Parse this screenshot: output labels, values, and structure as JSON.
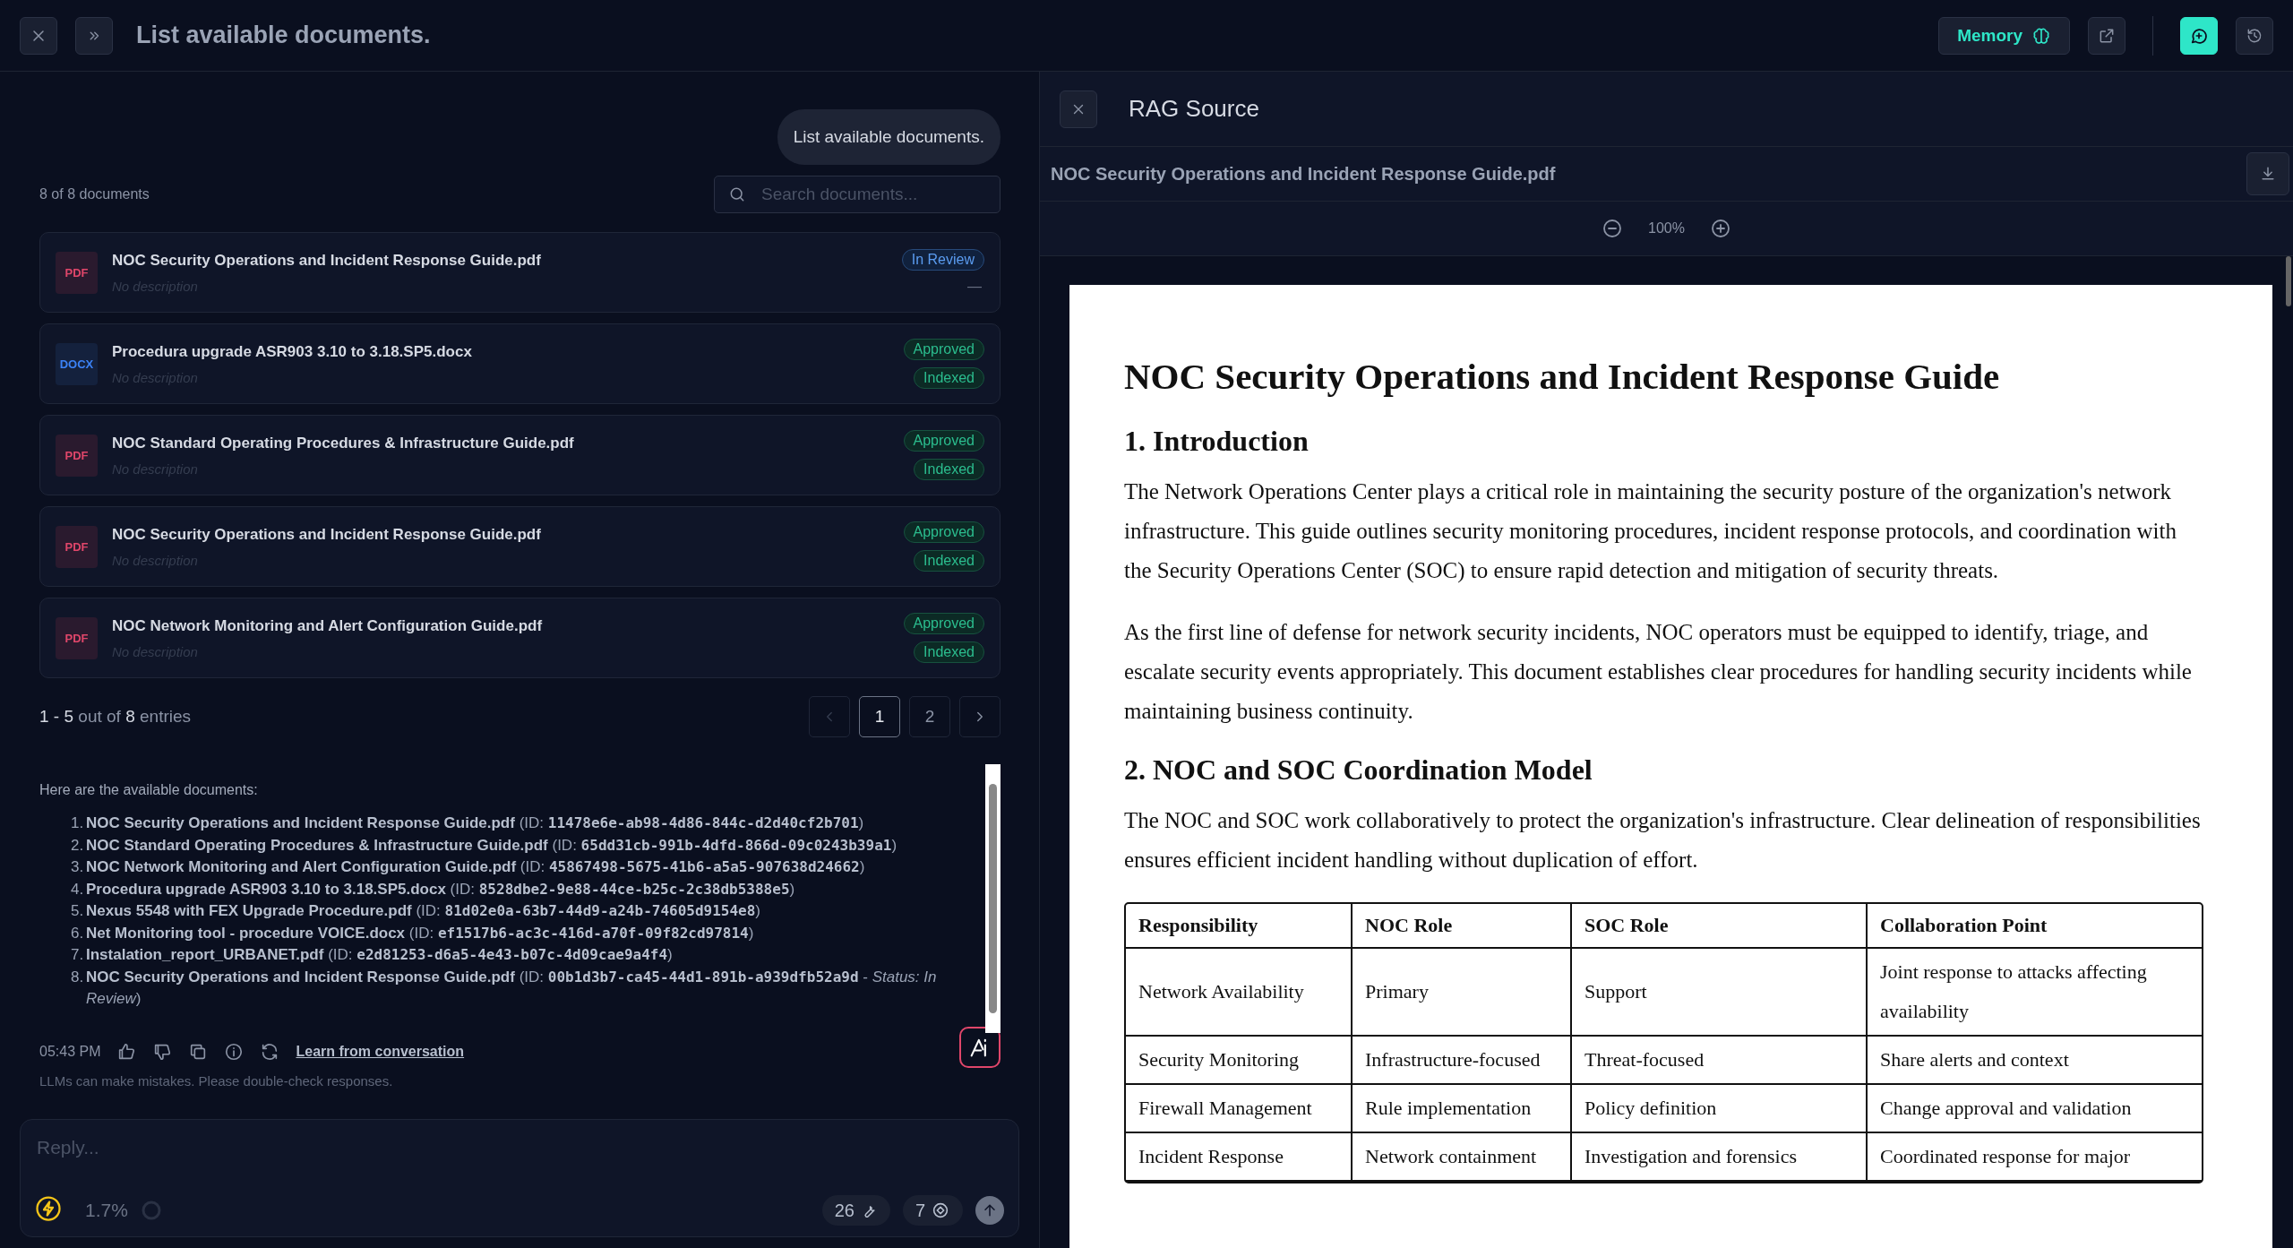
{
  "top_bar": {
    "title": "List available documents.",
    "memory_button": "Memory"
  },
  "chat": {
    "user_message": "List available documents.",
    "document_list": {
      "count_label": "8 of 8 documents",
      "search": {
        "placeholder": "Search documents..."
      },
      "documents": [
        {
          "file_type": "PDF",
          "kind": "pdf",
          "name": "NOC Security Operations and Incident Response Guide.pdf",
          "description": "No description",
          "badges": [
            {
              "label": "In Review",
              "kind": "review"
            },
            {
              "label": "—",
              "kind": "dash"
            }
          ]
        },
        {
          "file_type": "DOCX",
          "kind": "docx",
          "name": "Procedura upgrade ASR903 3.10 to 3.18.SP5.docx",
          "description": "No description",
          "badges": [
            {
              "label": "Approved",
              "kind": "approved"
            },
            {
              "label": "Indexed",
              "kind": "approved"
            }
          ]
        },
        {
          "file_type": "PDF",
          "kind": "pdf",
          "name": "NOC Standard Operating Procedures & Infrastructure Guide.pdf",
          "description": "No description",
          "badges": [
            {
              "label": "Approved",
              "kind": "approved"
            },
            {
              "label": "Indexed",
              "kind": "approved"
            }
          ]
        },
        {
          "file_type": "PDF",
          "kind": "pdf",
          "name": "NOC Security Operations and Incident Response Guide.pdf",
          "description": "No description",
          "badges": [
            {
              "label": "Approved",
              "kind": "approved"
            },
            {
              "label": "Indexed",
              "kind": "approved"
            }
          ]
        },
        {
          "file_type": "PDF",
          "kind": "pdf",
          "name": "NOC Network Monitoring and Alert Configuration Guide.pdf",
          "description": "No description",
          "badges": [
            {
              "label": "Approved",
              "kind": "approved"
            },
            {
              "label": "Indexed",
              "kind": "approved"
            }
          ]
        }
      ],
      "pagination": {
        "range": "1 - 5",
        "middle": "out of",
        "total": "8",
        "suffix": "entries",
        "prev_disabled": true,
        "pages": [
          {
            "label": "1",
            "selected": true
          },
          {
            "label": "2",
            "selected": false
          }
        ]
      }
    },
    "assistant": {
      "intro": "Here are the available documents:",
      "items": [
        {
          "number": "1.",
          "name": "NOC Security Operations and Incident Response Guide.pdf",
          "prefix": "(ID:",
          "id": "11478e6e-ab98-4d86-844c-d2d40cf2b701",
          "suffix": ")"
        },
        {
          "number": "2.",
          "name": "NOC Standard Operating Procedures & Infrastructure Guide.pdf",
          "prefix": "(ID:",
          "id": "65dd31cb-991b-4dfd-866d-09c0243b39a1",
          "suffix": ")"
        },
        {
          "number": "3.",
          "name": "NOC Network Monitoring and Alert Configuration Guide.pdf",
          "prefix": "(ID:",
          "id": "45867498-5675-41b6-a5a5-907638d24662",
          "suffix": ")"
        },
        {
          "number": "4.",
          "name": "Procedura upgrade ASR903 3.10 to 3.18.SP5.docx",
          "prefix": "(ID:",
          "id": "8528dbe2-9e88-44ce-b25c-2c38db5388e5",
          "suffix": ")"
        },
        {
          "number": "5.",
          "name": "Nexus 5548 with FEX Upgrade Procedure.pdf",
          "prefix": "(ID:",
          "id": "81d02e0a-63b7-44d9-a24b-74605d9154e8",
          "suffix": ")"
        },
        {
          "number": "6.",
          "name": "Net Monitoring tool - procedure VOICE.docx",
          "prefix": "(ID:",
          "id": "ef1517b6-ac3c-416d-a70f-09f82cd97814",
          "suffix": ")"
        },
        {
          "number": "7.",
          "name": "Instalation_report_URBANET.pdf",
          "prefix": "(ID:",
          "id": "e2d81253-d6a5-4e43-b07c-4d09cae9a4f4",
          "suffix": ")"
        },
        {
          "number": "8.",
          "name": "NOC Security Operations and Incident Response Guide.pdf",
          "prefix": "(ID:",
          "id": "00b1d3b7-ca45-44d1-891b-a939dfb52a9d",
          "suffix": " - *Status: In Review*)"
        }
      ],
      "time": "05:43 PM",
      "learn_link": "Learn from conversation",
      "disclaimer": "LLMs can make mistakes. Please double-check responses."
    },
    "composer": {
      "placeholder": "Reply...",
      "usage": "1.7%",
      "tools_count": "26",
      "sources_count": "7"
    }
  },
  "rag_source": {
    "title": "RAG Source",
    "file_name": "NOC Security Operations and Incident Response Guide.pdf",
    "zoom": "100%",
    "document": {
      "title": "NOC Security Operations and Incident Response Guide",
      "sections": [
        {
          "heading": "1. Introduction",
          "paragraphs": [
            "The Network Operations Center plays a critical role in maintaining the security posture of the organization's network infrastructure. This guide outlines security monitoring procedures, incident response protocols, and coordination with the Security Operations Center (SOC) to ensure rapid detection and mitigation of security threats.",
            "As the first line of defense for network security incidents, NOC operators must be equipped to identify, triage, and escalate security events appropriately. This document establishes clear procedures for handling security incidents while maintaining business continuity."
          ]
        },
        {
          "heading": "2. NOC and SOC Coordination Model",
          "paragraphs": [
            "The NOC and SOC work collaboratively to protect the organization's infrastructure. Clear delineation of responsibilities ensures efficient incident handling without duplication of effort."
          ]
        }
      ],
      "table": {
        "columns": [
          "Responsibility",
          "NOC Role",
          "SOC Role",
          "Collaboration Point"
        ],
        "rows": [
          [
            "Network Availability",
            "Primary",
            "Support",
            "Joint response to attacks affecting availability"
          ],
          [
            "Security Monitoring",
            "Infrastructure-focused",
            "Threat-focused",
            "Share alerts and context"
          ],
          [
            "Firewall Management",
            "Rule implementation",
            "Policy definition",
            "Change approval and validation"
          ],
          [
            "Incident Response",
            "Network containment",
            "Investigation and forensics",
            "Coordinated response for major"
          ]
        ]
      }
    }
  }
}
